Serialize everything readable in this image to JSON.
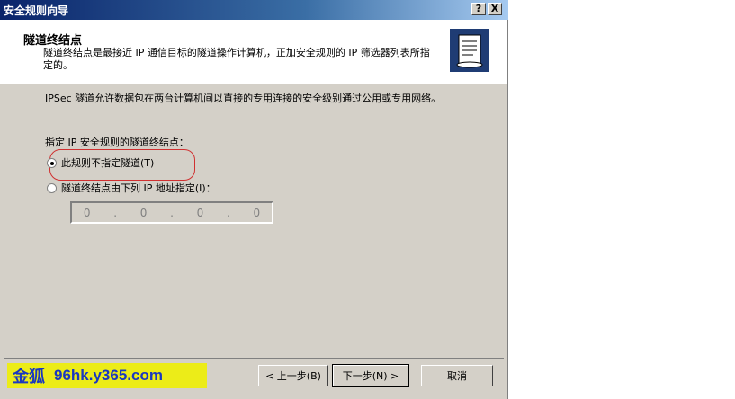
{
  "window": {
    "title": "安全规则向导",
    "help_btn": "?",
    "close_btn": "X"
  },
  "header": {
    "title": "隧道终结点",
    "description": "隧道终结点是最接近 IP 通信目标的隧道操作计算机，正加安全规则的 IP 筛选器列表所指定的。"
  },
  "body": {
    "intro": "IPSec 隧道允许数据包在两台计算机间以直接的专用连接的安全级别通过公用或专用网络。",
    "group_label": "指定 IP 安全规则的隧道终结点：",
    "options": [
      {
        "label": "此规则不指定隧道(T)",
        "selected": true
      },
      {
        "label": "隧道终结点由下列 IP 地址指定(I)：",
        "selected": false
      }
    ],
    "ip": {
      "octets": [
        "0",
        "0",
        "0",
        "0"
      ],
      "dot": "."
    }
  },
  "buttons": {
    "back": "< 上一步(B)",
    "next": "下一步(N) >",
    "cancel": "取消"
  },
  "watermark": {
    "name": "金狐",
    "url": "96hk.y365.com"
  },
  "colors": {
    "titlebar": "#0a246a",
    "dialog_bg": "#d4d0c8",
    "highlight": "#d03030",
    "logo_bg": "#ecec18"
  }
}
